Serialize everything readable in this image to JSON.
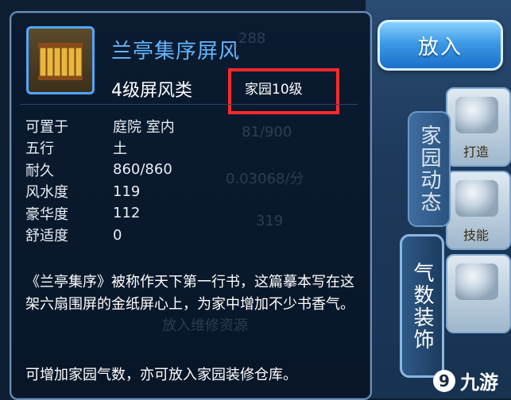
{
  "item": {
    "name": "兰亭集序屏风",
    "type": "4级屏风类",
    "level_req": "家园10级"
  },
  "attributes": [
    {
      "label": "可置于",
      "value": "庭院  室内"
    },
    {
      "label": "五行",
      "value": "土"
    },
    {
      "label": "耐久",
      "value": "860/860"
    },
    {
      "label": "风水度",
      "value": "119"
    },
    {
      "label": "豪华度",
      "value": "112"
    },
    {
      "label": "舒适度",
      "value": "0"
    }
  ],
  "description": "《兰亭集序》被称作天下第一行书，这篇摹本写在这架六扇围屏的金纸屏心上，为家中增加不少书香气。",
  "note": "可增加家园气数，亦可放入家园装修仓库。",
  "buttons": {
    "put": "放入"
  },
  "side_tabs": {
    "home_news": "家园动态",
    "decor": "气数装饰"
  },
  "right_tiles": {
    "forge": "打造",
    "skill": "技能"
  },
  "background_ghost": {
    "v1": "288",
    "v2": "81/900",
    "v3": "0.03068/分",
    "v4": "319",
    "v5": "放入维修资源"
  },
  "watermark": {
    "text": "九游"
  },
  "colors": {
    "name": "#63b6ff",
    "highlight_box": "#ff2a2a",
    "panel_bg": "#0b1b30"
  }
}
